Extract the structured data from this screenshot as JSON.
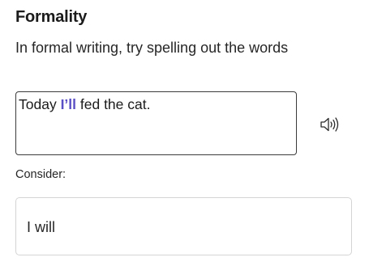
{
  "card": {
    "title": "Formality",
    "subtitle": "In formal writing, try spelling out the words"
  },
  "sentence": {
    "before": "Today ",
    "flagged": "I’ll",
    "after": " fed the cat.",
    "flag_color": "#5a4fc4"
  },
  "speaker": {
    "icon": "speaker-icon"
  },
  "consider": {
    "label": "Consider:"
  },
  "suggestion": {
    "text": "I will"
  }
}
